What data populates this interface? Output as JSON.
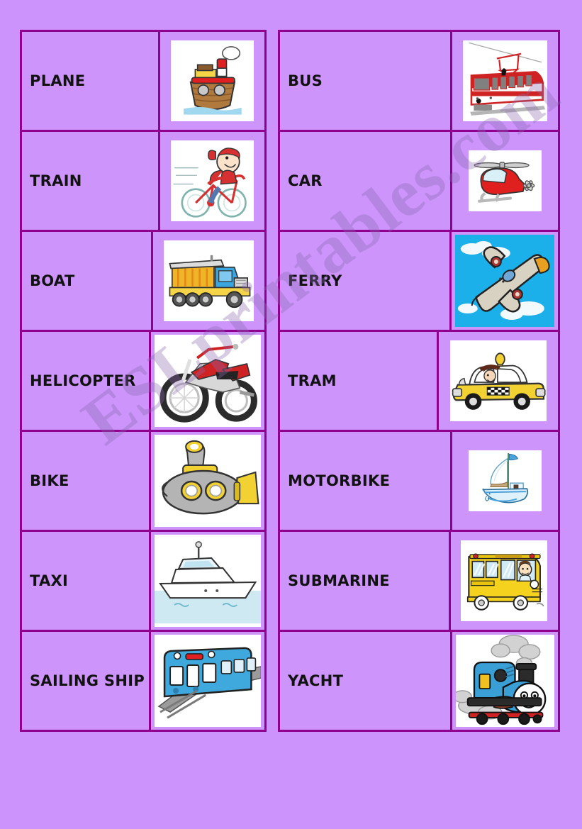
{
  "page": {
    "background_color": "#cc93fc",
    "border_color": "#8f008f",
    "card_color": "#cd95fb",
    "text_color": "#121212",
    "watermark": "ESLprintables.com"
  },
  "board": {
    "left_column": [
      {
        "word": "PLANE",
        "picture": "tugboat-picture"
      },
      {
        "word": "TRAIN",
        "picture": "girl-on-bicycle-picture"
      },
      {
        "word": "BOAT",
        "picture": "dump-truck-picture"
      },
      {
        "word": "HELICOPTER",
        "picture": "motorbike-picture"
      },
      {
        "word": "BIKE",
        "picture": "submarine-picture"
      },
      {
        "word": "TAXI",
        "picture": "yacht-picture"
      },
      {
        "word": "SAILING SHIP",
        "picture": "subway-train-picture"
      }
    ],
    "right_column": [
      {
        "word": "BUS",
        "picture": "tram-picture"
      },
      {
        "word": "CAR",
        "picture": "helicopter-picture"
      },
      {
        "word": "FERRY",
        "picture": "airplane-picture"
      },
      {
        "word": "TRAM",
        "picture": "taxi-cab-picture"
      },
      {
        "word": "MOTORBIKE",
        "picture": "sailing-ship-picture"
      },
      {
        "word": "SUBMARINE",
        "picture": "school-bus-picture"
      },
      {
        "word": "YACHT",
        "picture": "steam-locomotive-picture"
      }
    ]
  }
}
